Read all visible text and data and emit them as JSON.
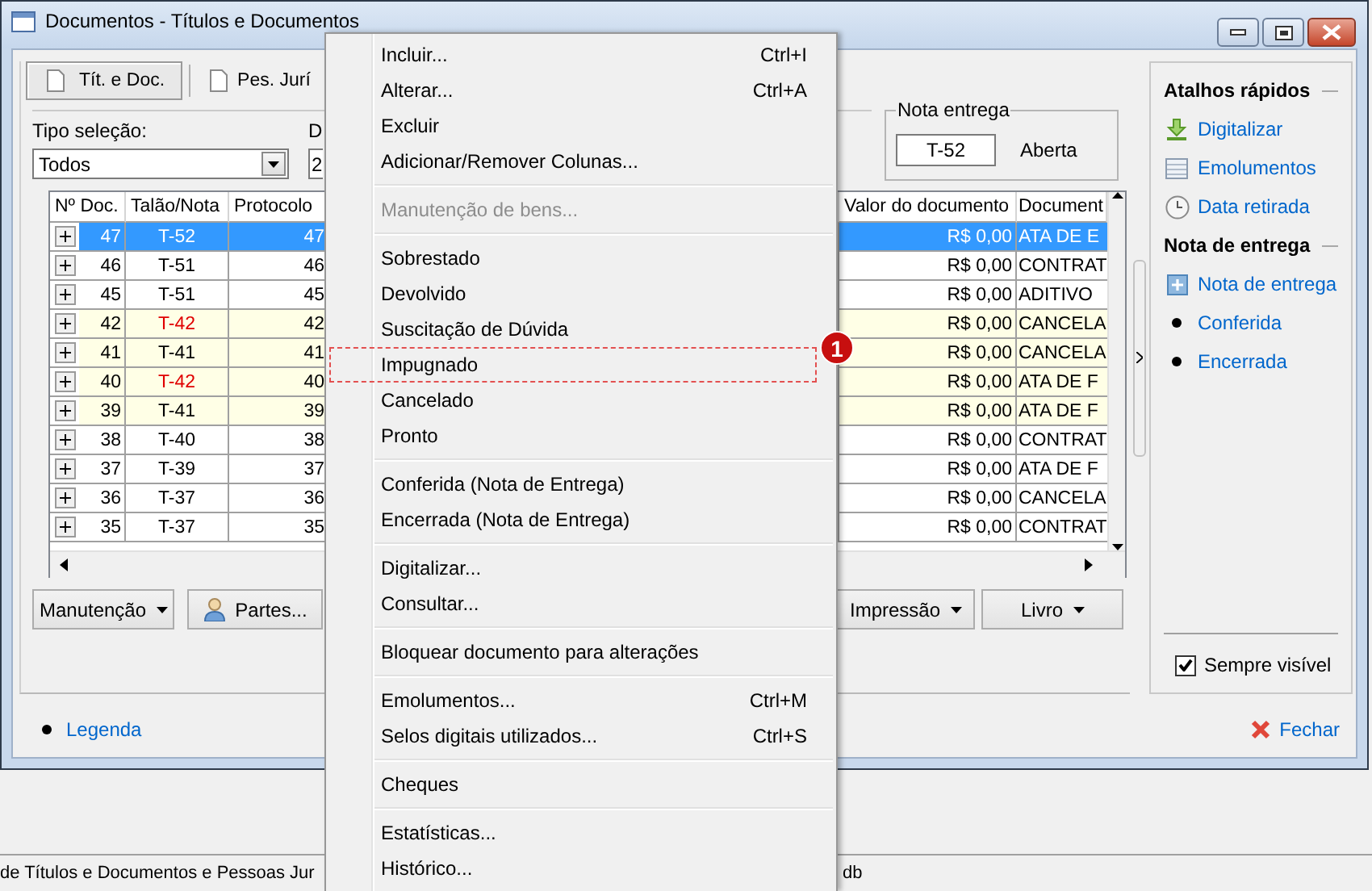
{
  "window": {
    "title": "Documentos - Títulos e Documentos"
  },
  "tabs": [
    {
      "label": "Tít. e Doc.",
      "selected": true
    },
    {
      "label": "Pes. Jurí",
      "selected": false
    }
  ],
  "filters": [
    {
      "label": "Tipo seleção:",
      "value": "Todos",
      "kind": "combo"
    },
    {
      "label": "D",
      "value": "2",
      "kind": "field"
    }
  ],
  "delivery_note": {
    "legend": "Nota entrega",
    "number": "T-52",
    "status": "Aberta"
  },
  "table": {
    "columns": [
      "Nº Doc.",
      "Talão/Nota",
      "Protocolo",
      "Valor do documento",
      "Document"
    ],
    "rows": [
      {
        "doc": "47",
        "talao": "T-52",
        "protocolo": "47",
        "valor": "R$ 0,00",
        "documento": "ATA DE E",
        "selected": true,
        "highlighted": false,
        "talao_flagged": false
      },
      {
        "doc": "46",
        "talao": "T-51",
        "protocolo": "46",
        "valor": "R$ 0,00",
        "documento": "CONTRAT",
        "selected": false,
        "highlighted": false,
        "talao_flagged": false
      },
      {
        "doc": "45",
        "talao": "T-51",
        "protocolo": "45",
        "valor": "R$ 0,00",
        "documento": "ADITIVO",
        "selected": false,
        "highlighted": false,
        "talao_flagged": false
      },
      {
        "doc": "42",
        "talao": "T-42",
        "protocolo": "42",
        "valor": "R$ 0,00",
        "documento": "CANCELA",
        "selected": false,
        "highlighted": true,
        "talao_flagged": true
      },
      {
        "doc": "41",
        "talao": "T-41",
        "protocolo": "41",
        "valor": "R$ 0,00",
        "documento": "CANCELA",
        "selected": false,
        "highlighted": true,
        "talao_flagged": false
      },
      {
        "doc": "40",
        "talao": "T-42",
        "protocolo": "40",
        "valor": "R$ 0,00",
        "documento": "ATA DE F",
        "selected": false,
        "highlighted": true,
        "talao_flagged": true
      },
      {
        "doc": "39",
        "talao": "T-41",
        "protocolo": "39",
        "valor": "R$ 0,00",
        "documento": "ATA DE F",
        "selected": false,
        "highlighted": true,
        "talao_flagged": false
      },
      {
        "doc": "38",
        "talao": "T-40",
        "protocolo": "38",
        "valor": "R$ 0,00",
        "documento": "CONTRAT",
        "selected": false,
        "highlighted": false,
        "talao_flagged": false
      },
      {
        "doc": "37",
        "talao": "T-39",
        "protocolo": "37",
        "valor": "R$ 0,00",
        "documento": "ATA DE F",
        "selected": false,
        "highlighted": false,
        "talao_flagged": false
      },
      {
        "doc": "36",
        "talao": "T-37",
        "protocolo": "36",
        "valor": "R$ 0,00",
        "documento": "CANCELA",
        "selected": false,
        "highlighted": false,
        "talao_flagged": false
      },
      {
        "doc": "35",
        "talao": "T-37",
        "protocolo": "35",
        "valor": "R$ 0,00",
        "documento": "CONTRAT",
        "selected": false,
        "highlighted": false,
        "talao_flagged": false
      }
    ]
  },
  "buttons_left": [
    {
      "label": "Manutenção",
      "kind": "dropdown"
    },
    {
      "label": "Partes...",
      "kind": "person"
    }
  ],
  "buttons_right": [
    {
      "label": "Impressão",
      "kind": "dropdown"
    },
    {
      "label": "Livro",
      "kind": "dropdown"
    }
  ],
  "legend_link": "Legenda",
  "close_link": "Fechar",
  "side_panel": {
    "sections": [
      {
        "title": "Atalhos rápidos",
        "items": [
          {
            "label": "Digitalizar",
            "kind": "download"
          },
          {
            "label": "Emolumentos",
            "kind": "table"
          },
          {
            "label": "Data retirada",
            "kind": "clock"
          }
        ]
      },
      {
        "title": "Nota de entrega",
        "items": [
          {
            "label": "Nota de entrega",
            "kind": "add"
          },
          {
            "label": "Conferida",
            "kind": "bullet"
          },
          {
            "label": "Encerrada",
            "kind": "bullet"
          }
        ]
      }
    ],
    "always_visible": {
      "label": "Sempre visível",
      "checked": true
    }
  },
  "context_menu": {
    "callout": "1",
    "groups": [
      [
        {
          "label": "Incluir...",
          "shortcut": "Ctrl+I",
          "disabled": false,
          "marked": false
        },
        {
          "label": "Alterar...",
          "shortcut": "Ctrl+A",
          "disabled": false,
          "marked": false
        },
        {
          "label": "Excluir",
          "disabled": false,
          "marked": false
        },
        {
          "label": "Adicionar/Remover Colunas...",
          "disabled": false,
          "marked": false
        }
      ],
      [
        {
          "label": "Manutenção de bens...",
          "disabled": true,
          "marked": false
        }
      ],
      [
        {
          "label": "Sobrestado",
          "disabled": false,
          "marked": false
        },
        {
          "label": "Devolvido",
          "disabled": false,
          "marked": false
        },
        {
          "label": "Suscitação de Dúvida",
          "disabled": false,
          "marked": false
        },
        {
          "label": "Impugnado",
          "disabled": false,
          "marked": true
        },
        {
          "label": "Cancelado",
          "disabled": false,
          "marked": false
        },
        {
          "label": "Pronto",
          "disabled": false,
          "marked": false
        }
      ],
      [
        {
          "label": "Conferida (Nota de Entrega)",
          "disabled": false,
          "marked": false
        },
        {
          "label": "Encerrada (Nota de Entrega)",
          "disabled": false,
          "marked": false
        }
      ],
      [
        {
          "label": "Digitalizar...",
          "disabled": false,
          "marked": false
        },
        {
          "label": "Consultar...",
          "disabled": false,
          "marked": false
        }
      ],
      [
        {
          "label": "Bloquear documento para alterações",
          "disabled": false,
          "marked": false
        }
      ],
      [
        {
          "label": "Emolumentos...",
          "shortcut": "Ctrl+M",
          "disabled": false,
          "marked": false
        },
        {
          "label": "Selos digitais utilizados...",
          "shortcut": "Ctrl+S",
          "disabled": false,
          "marked": false
        }
      ],
      [
        {
          "label": "Cheques",
          "disabled": false,
          "marked": false
        }
      ],
      [
        {
          "label": "Estatísticas...",
          "disabled": false,
          "marked": false
        },
        {
          "label": "Histórico...",
          "disabled": false,
          "marked": false
        }
      ]
    ]
  },
  "status_bar": [
    "de Títulos e Documentos e Pessoas Jur",
    "db"
  ]
}
